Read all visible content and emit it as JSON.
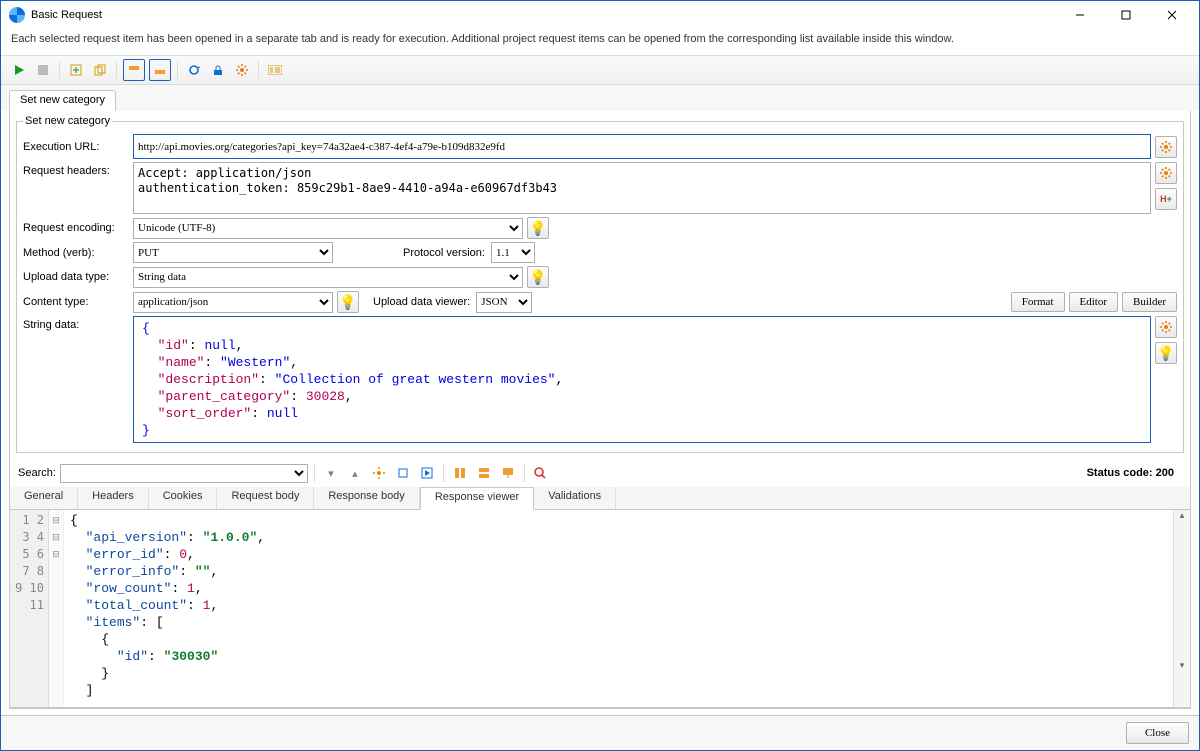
{
  "window": {
    "title": "Basic Request"
  },
  "description": "Each selected request item has been opened in a separate tab and is ready for execution. Additional project request items can be opened from the corresponding list available inside this window.",
  "top_tab": "Set new category",
  "fieldset_title": "Set new category",
  "labels": {
    "execution_url": "Execution URL:",
    "request_headers": "Request headers:",
    "request_encoding": "Request encoding:",
    "method": "Method (verb):",
    "protocol_version": "Protocol version:",
    "upload_data_type": "Upload data type:",
    "content_type": "Content type:",
    "upload_data_viewer": "Upload data viewer:",
    "string_data": "String data:",
    "search": "Search:"
  },
  "values": {
    "execution_url": "http://api.movies.org/categories?api_key=74a32ae4-c387-4ef4-a79e-b109d832e9fd",
    "headers": "Accept: application/json\nauthentication_token: 859c29b1-8ae9-4410-a94a-e60967df3b43",
    "encoding": "Unicode (UTF-8)",
    "method": "PUT",
    "protocol": "1.1",
    "upload_type": "String data",
    "content_type": "application/json",
    "upload_viewer": "JSON"
  },
  "buttons": {
    "format": "Format",
    "editor": "Editor",
    "builder": "Builder",
    "close": "Close"
  },
  "status": "Status code: 200",
  "bottom_tabs": [
    "General",
    "Headers",
    "Cookies",
    "Request body",
    "Response body",
    "Response viewer",
    "Validations"
  ],
  "request_json": {
    "id": null,
    "name": "Western",
    "description": "Collection of great western movies",
    "parent_category": 30028,
    "sort_order": null
  },
  "response_json": {
    "api_version": "1.0.0",
    "error_id": 0,
    "error_info": "",
    "row_count": 1,
    "total_count": 1,
    "items": [
      {
        "id": "30030"
      }
    ]
  },
  "response_lines": 11
}
